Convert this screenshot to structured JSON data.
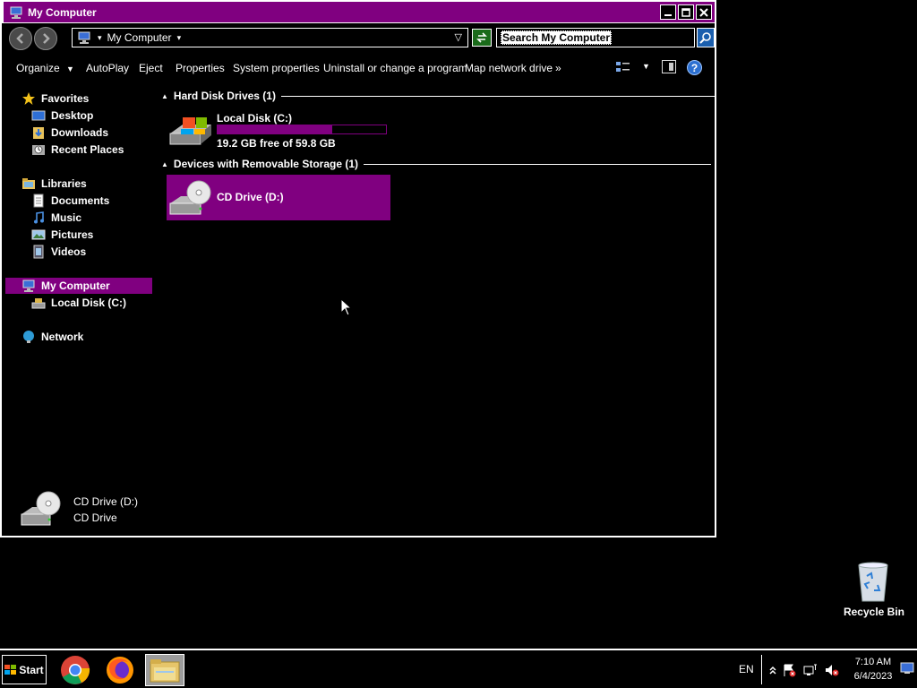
{
  "window": {
    "title": "My Computer",
    "accent_color": "#800080"
  },
  "address": {
    "location": "My Computer",
    "search_placeholder": "Search My Computer"
  },
  "toolbar": {
    "organize": "Organize",
    "autoplay": "AutoPlay",
    "eject": "Eject",
    "properties": "Properties",
    "system_properties": "System properties",
    "uninstall": "Uninstall or change a program",
    "map_network_drive": "Map network drive",
    "more": "»"
  },
  "nav": {
    "favorites": "Favorites",
    "desktop": "Desktop",
    "downloads": "Downloads",
    "recent_places": "Recent Places",
    "libraries": "Libraries",
    "documents": "Documents",
    "music": "Music",
    "pictures": "Pictures",
    "videos": "Videos",
    "my_computer": "My Computer",
    "local_disk": "Local Disk (C:)",
    "network": "Network"
  },
  "content": {
    "hard_disk_header": "Hard Disk Drives (1)",
    "local_disk_name": "Local Disk (C:)",
    "local_disk_free": "19.2 GB free of 59.8 GB",
    "local_disk_used_fraction": 0.68,
    "removable_header": "Devices with Removable Storage (1)",
    "cd_drive_name": "CD Drive (D:)"
  },
  "details": {
    "name": "CD Drive (D:)",
    "type": "CD Drive"
  },
  "desktop": {
    "recycle_bin": "Recycle Bin"
  },
  "taskbar": {
    "start": "Start",
    "language": "EN",
    "time": "7:10 AM",
    "date": "6/4/2023"
  }
}
